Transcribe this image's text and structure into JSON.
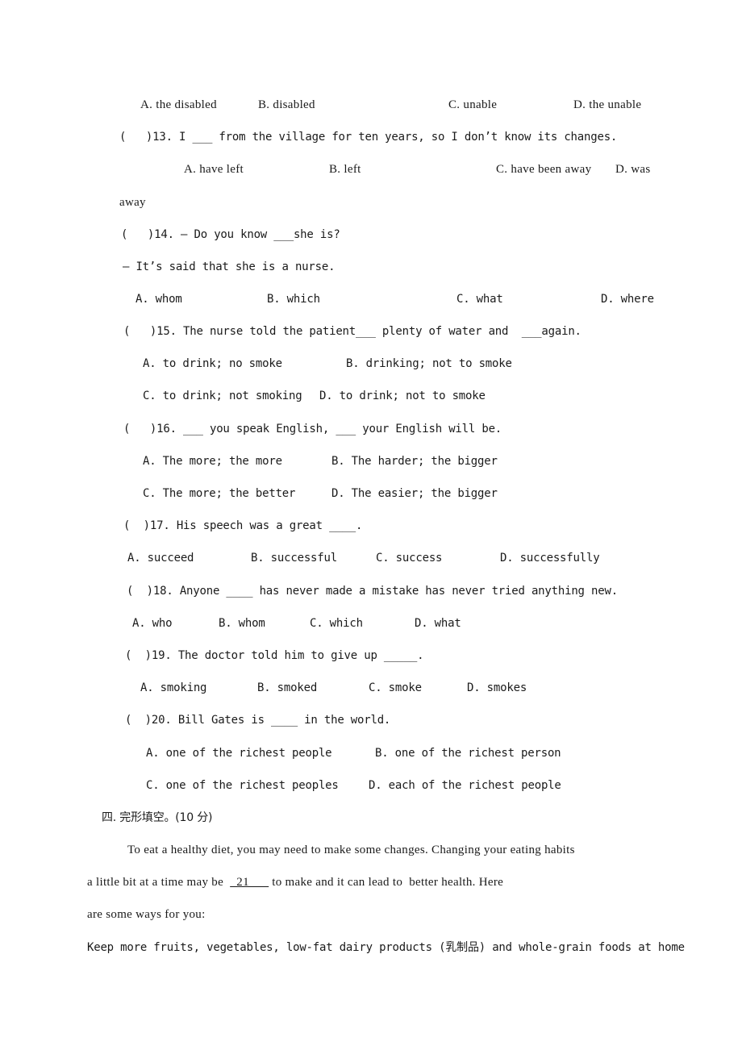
{
  "q12_options": {
    "a": "A. the disabled",
    "b": "B. disabled",
    "c": "C. unable",
    "d": "D. the unable"
  },
  "q13": {
    "stem": "(   )13. I ___ from the village for ten years, so I don’t know its changes.",
    "a": "A. have left",
    "b": "B. left",
    "c": "C. have been away",
    "d": "D. was",
    "wrap": "away"
  },
  "q14": {
    "stem": "(   )14. — Do you know ___she is?",
    "reply": "— It’s said that she is a nurse.",
    "a": "A. whom",
    "b": "B. which",
    "c": "C. what",
    "d": "D. where"
  },
  "q15": {
    "stem": "(   )15. The nurse told the patient___ plenty of water and  ___again.",
    "a": "A. to drink; no smoke",
    "b": "B. drinking; not to smoke",
    "c": "C. to drink; not smoking",
    "d": "D. to drink; not to smoke"
  },
  "q16": {
    "stem": "(   )16. ___ you speak English, ___ your English will be.",
    "a": "A. The more; the more",
    "b": "B. The harder; the bigger",
    "c": "C. The more; the better",
    "d": "D. The easier; the bigger"
  },
  "q17": {
    "stem": "(  )17. His speech was a great ____.",
    "a": "A. succeed",
    "b": "B. successful",
    "c": "C. success",
    "d": "D. successfully"
  },
  "q18": {
    "stem": "(  )18. Anyone ____ has never made a mistake has never tried anything new.",
    "a": "A. who",
    "b": "B. whom",
    "c": "C. which",
    "d": "D. what"
  },
  "q19": {
    "stem": "(  )19. The doctor told him to give up _____.",
    "a": "A. smoking",
    "b": "B. smoked",
    "c": "C. smoke",
    "d": "D. smokes"
  },
  "q20": {
    "stem": "(  )20. Bill Gates is ____ in the world.",
    "a": "A. one of the richest people",
    "b": "B. one of the richest person",
    "c": "C. one of the richest peoples",
    "d": "D. each of the richest people"
  },
  "section4": {
    "heading": "四. 完形填空。(10 分)",
    "p1": "To eat a healthy diet, you may need to make some changes. Changing your eating habits",
    "p2_pre": "a little bit at a time may be  ",
    "p2_blank": "  21      ",
    "p2_post": " to make and it can lead to  better health. Here",
    "p3": "are some ways for you:",
    "p4": "Keep more fruits, vegetables, low-fat dairy products (乳制品) and whole-grain foods at home"
  }
}
